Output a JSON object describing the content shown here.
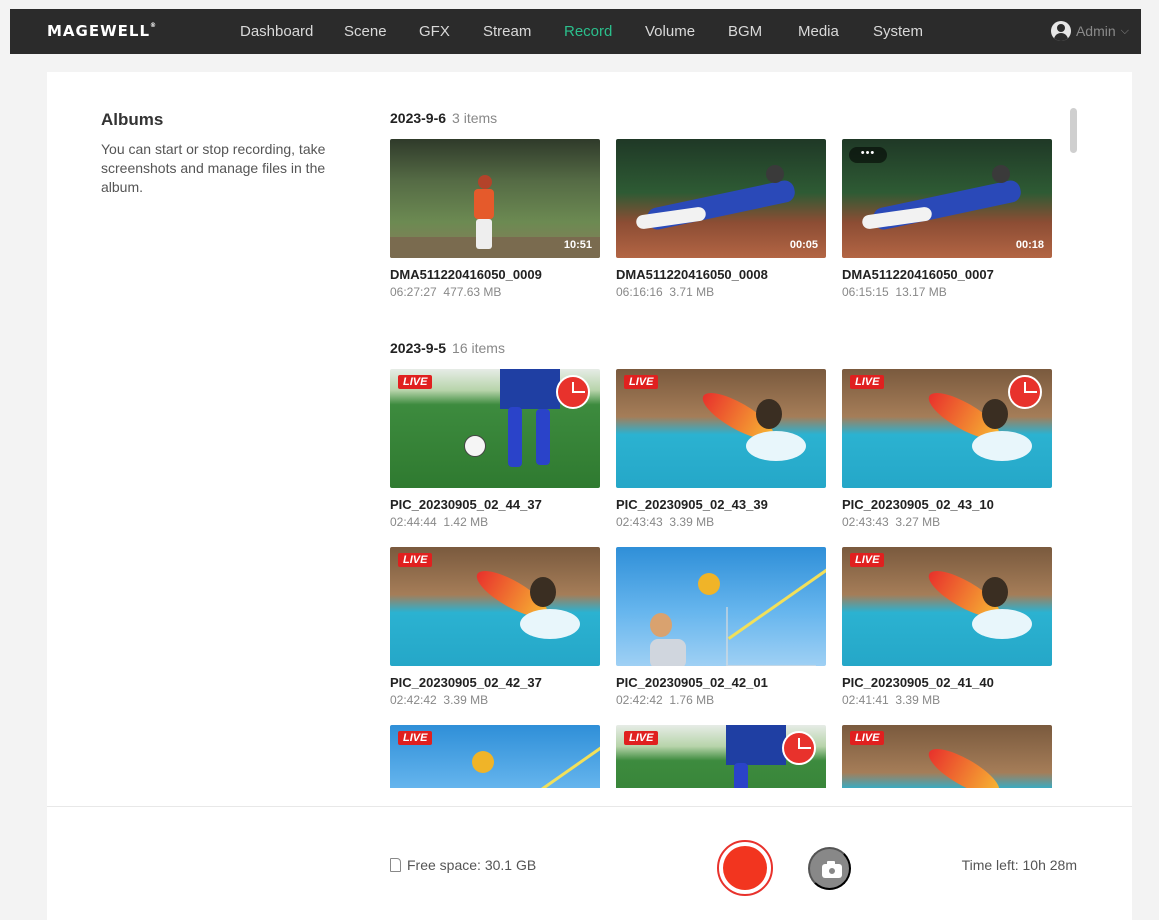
{
  "brand": {
    "logo": "MAGEWELL",
    "registered": "®"
  },
  "nav": [
    {
      "label": "Dashboard"
    },
    {
      "label": "Scene"
    },
    {
      "label": "GFX"
    },
    {
      "label": "Stream"
    },
    {
      "label": "Record",
      "active": true
    },
    {
      "label": "Volume"
    },
    {
      "label": "BGM"
    },
    {
      "label": "Media"
    },
    {
      "label": "System"
    }
  ],
  "user": {
    "name": "Admin",
    "chevron": "⌵"
  },
  "sidebar": {
    "title": "Albums",
    "description": "You can start or stop recording, take screenshots and manage files in the album."
  },
  "groups": [
    {
      "date": "2023-9-6",
      "count": "3 items",
      "items": [
        {
          "name": "DMA511220416050_0009",
          "time": "06:27:27",
          "size": "477.63 MB",
          "duration": "10:51",
          "scene": "pitcher"
        },
        {
          "name": "DMA511220416050_0008",
          "time": "06:16:16",
          "size": "3.71 MB",
          "duration": "00:05",
          "scene": "slide"
        },
        {
          "name": "DMA511220416050_0007",
          "time": "06:15:15",
          "size": "13.17 MB",
          "duration": "00:18",
          "scene": "slide",
          "more": "•••"
        }
      ]
    },
    {
      "date": "2023-9-5",
      "count": "16 items",
      "items": [
        {
          "name": "PIC_20230905_02_44_37",
          "time": "02:44:44",
          "size": "1.42 MB",
          "live": "LIVE",
          "scene": "soccer",
          "clock": true
        },
        {
          "name": "PIC_20230905_02_43_39",
          "time": "02:43:43",
          "size": "3.39 MB",
          "live": "LIVE",
          "scene": "surf"
        },
        {
          "name": "PIC_20230905_02_43_10",
          "time": "02:43:43",
          "size": "3.27 MB",
          "live": "LIVE",
          "scene": "surf",
          "clock": true
        },
        {
          "name": "PIC_20230905_02_42_37",
          "time": "02:42:42",
          "size": "3.39 MB",
          "live": "LIVE",
          "scene": "surf"
        },
        {
          "name": "PIC_20230905_02_42_01",
          "time": "02:42:42",
          "size": "1.76 MB",
          "scene": "volley"
        },
        {
          "name": "PIC_20230905_02_41_40",
          "time": "02:41:41",
          "size": "3.39 MB",
          "live": "LIVE",
          "scene": "surf"
        },
        {
          "name": "",
          "time": "",
          "size": "",
          "live": "LIVE",
          "scene": "volley"
        },
        {
          "name": "",
          "time": "",
          "size": "",
          "live": "LIVE",
          "scene": "soccer",
          "clock": true
        },
        {
          "name": "",
          "time": "",
          "size": "",
          "live": "LIVE",
          "scene": "surf"
        }
      ]
    }
  ],
  "footer": {
    "free_space": "Free space: 30.1 GB",
    "time_left": "Time left: 10h 28m"
  },
  "icons": [
    "user-avatar-icon",
    "sd-card-icon",
    "record-icon",
    "camera-icon",
    "clock-icon"
  ],
  "colors": {
    "topbar": "#2b2b2b",
    "active_nav": "#2bbf8c",
    "record": "#f2351f",
    "live_badge": "#e0201f"
  }
}
